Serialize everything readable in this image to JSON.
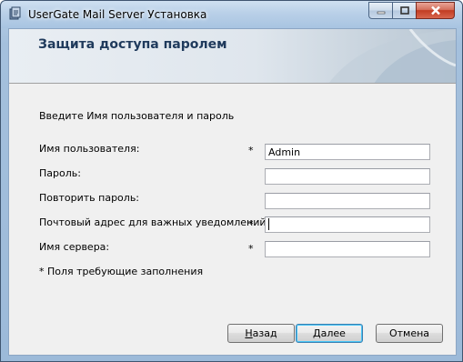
{
  "window": {
    "title": "UserGate Mail Server Установка",
    "icon": "installer-icon"
  },
  "banner": {
    "title": "Защита доступа паролем"
  },
  "form": {
    "instruction": "Введите Имя пользователя и пароль",
    "fields": [
      {
        "label": "Имя пользователя:",
        "required": "*",
        "value": "Admin"
      },
      {
        "label": "Пароль:",
        "required": "",
        "value": ""
      },
      {
        "label": "Повторить пароль:",
        "required": "",
        "value": ""
      },
      {
        "label": "Почтовый адрес для важных уведомлений:",
        "required": "*",
        "value": ""
      },
      {
        "label": "Имя сервера:",
        "required": "*",
        "value": ""
      }
    ],
    "required_note": "* Поля требующие заполнения"
  },
  "buttons": {
    "back_access_key": "Н",
    "back_rest": "азад",
    "next_access_key": "Д",
    "next_rest": "алее",
    "cancel": "Отмена"
  }
}
